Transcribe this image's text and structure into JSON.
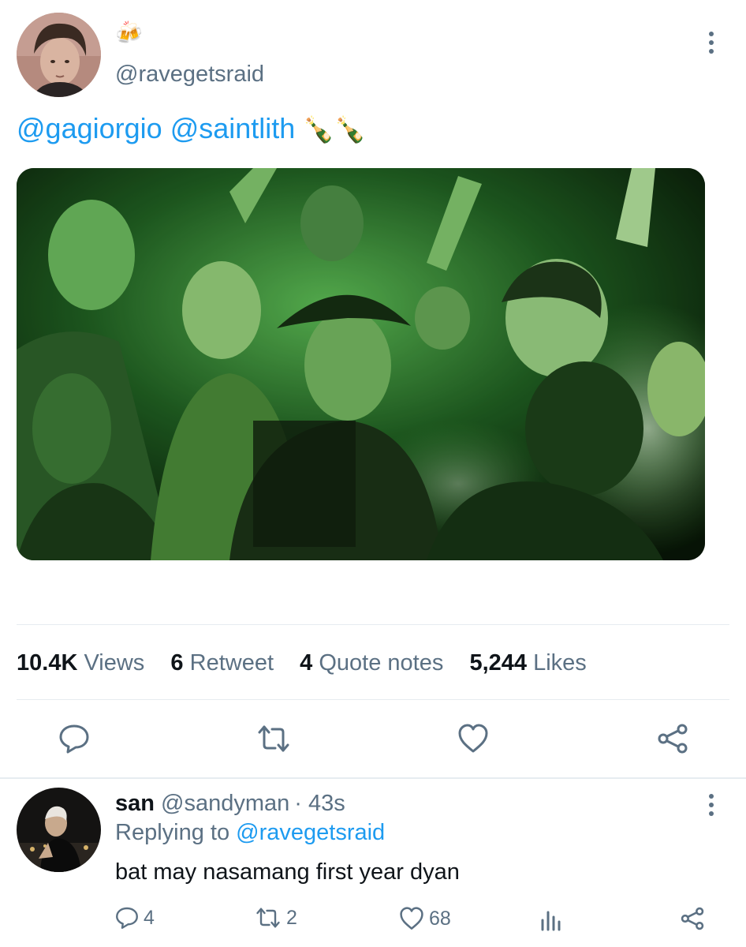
{
  "post": {
    "author_handle": "@ravegetsraid",
    "name_emoji": "🍻",
    "mentions": [
      "@gagiorgio",
      "@saintlith"
    ],
    "text_emoji": "🍾🍾",
    "stats": {
      "views_count": "10.4K",
      "views_label": "Views",
      "retweet_count": "6",
      "retweet_label": "Retweet",
      "quote_count": "4",
      "quote_label": "Quote notes",
      "likes_count": "5,244",
      "likes_label": "Likes"
    },
    "actions": [
      "reply-icon",
      "retweet-icon",
      "like-icon",
      "share-icon"
    ]
  },
  "reply": {
    "name": "san",
    "handle": "@sandyman",
    "separator": "·",
    "time": "43s",
    "replying_prefix": "Replying to",
    "replying_to": "@ravegetsraid",
    "text": "bat may nasamang first year dyan",
    "reply_count": "4",
    "retweet_count": "2",
    "like_count": "68"
  },
  "colors": {
    "link": "#1d9bf0",
    "muted": "#5b7083",
    "text": "#0f1419",
    "divider": "#e6ecf0"
  }
}
